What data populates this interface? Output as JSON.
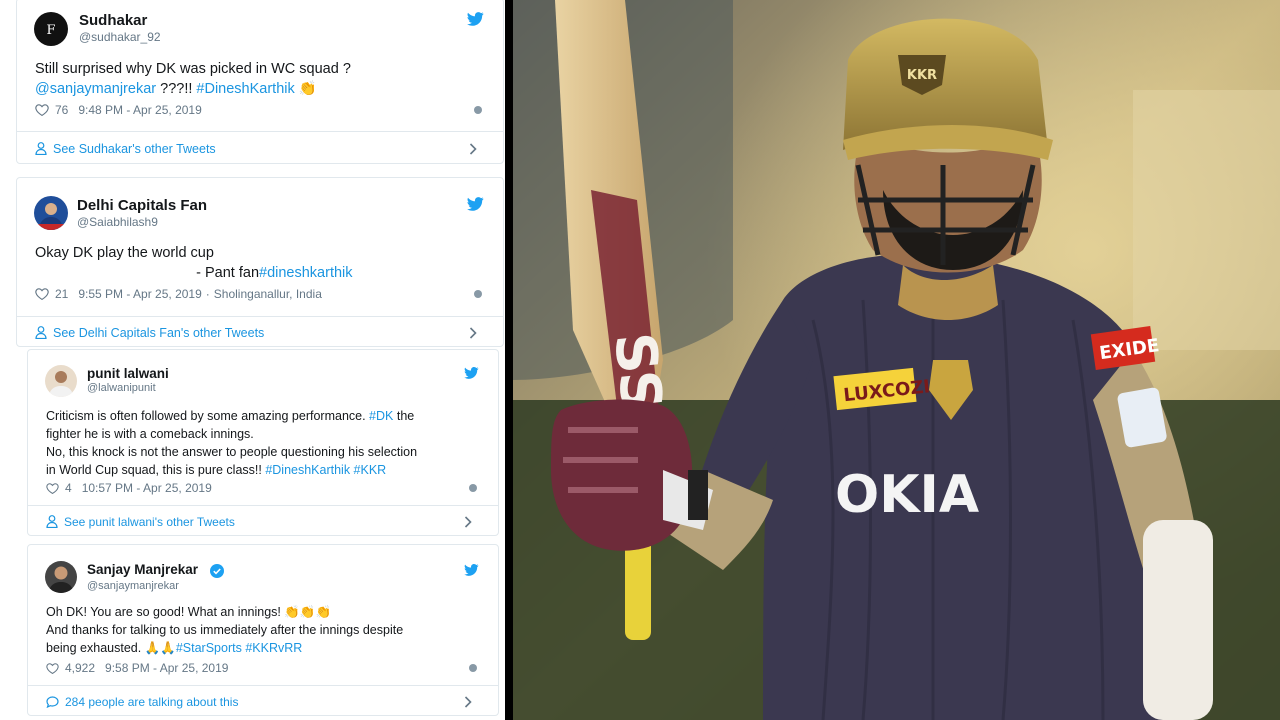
{
  "tweets": [
    {
      "name": "Sudhakar",
      "handle": "@sudhakar_92",
      "text_parts": [
        {
          "t": "Still surprised why DK was picked in WC squad ?\n",
          "c": ""
        },
        {
          "t": "@sanjaymanjrekar",
          "c": "tag"
        },
        {
          "t": " ???!! ",
          "c": ""
        },
        {
          "t": "#DineshKarthik",
          "c": "tag"
        },
        {
          "t": " 👏",
          "c": "clap"
        }
      ],
      "likes": "76",
      "time": "9:48 PM - Apr 25, 2019",
      "location": "",
      "footer": "See Sudhakar's other Tweets"
    },
    {
      "name": "Delhi Capitals Fan",
      "handle": "@Saiabhilash9",
      "text_parts": [
        {
          "t": "Okay DK play the world cup\n                                        - Pant fan",
          "c": ""
        },
        {
          "t": "#dineshkarthik",
          "c": "tag"
        }
      ],
      "likes": "21",
      "time": "9:55 PM - Apr 25, 2019",
      "location": "Sholinganallur, India",
      "footer": "See Delhi Capitals Fan's other Tweets"
    },
    {
      "name": "punit lalwani",
      "handle": "@lalwanipunit",
      "text_parts": [
        {
          "t": "Criticism is often followed by some amazing performance. ",
          "c": ""
        },
        {
          "t": "#DK",
          "c": "tag"
        },
        {
          "t": " the\nfighter he is with a comeback innings.\nNo, this knock is not the answer to people questioning his selection\nin World Cup squad, this is pure class!! ",
          "c": ""
        },
        {
          "t": "#DineshKarthik #KKR",
          "c": "tag"
        }
      ],
      "likes": "4",
      "time": "10:57 PM - Apr 25, 2019",
      "location": "",
      "footer": "See punit lalwani's other Tweets"
    },
    {
      "name": "Sanjay Manjrekar",
      "handle": "@sanjaymanjrekar",
      "verified": true,
      "text_parts": [
        {
          "t": "Oh DK! You are so good! What an innings! ",
          "c": ""
        },
        {
          "t": "👏👏👏",
          "c": "clap"
        },
        {
          "t": "\nAnd thanks for talking to us immediately after the innings despite\nbeing exhausted. ",
          "c": ""
        },
        {
          "t": "🙏🙏",
          "c": "clap"
        },
        {
          "t": "#StarSports #KKRvRR",
          "c": "tag"
        }
      ],
      "likes": "4,922",
      "time": "9:58 PM - Apr 25, 2019",
      "location": "",
      "footer": "284 people are talking about this"
    }
  ],
  "photo": {
    "sponsor_jersey": "OKIA",
    "sponsor_chest": "LUXCOZI",
    "sleeve_badge": "EXIDE",
    "helmet_badge": "KKR",
    "bat_brand": "SS"
  },
  "colors": {
    "accent": "#1b95e0",
    "text": "#14171a",
    "muted": "#657786",
    "border": "#e1e8ed",
    "jersey": "#3b3850",
    "helmet": "#b79a48"
  },
  "icons": [
    "twitter-bird-icon",
    "heart-icon",
    "info-icon",
    "person-icon",
    "chevron-right-icon",
    "speech-bubble-icon",
    "verified-badge-icon"
  ]
}
